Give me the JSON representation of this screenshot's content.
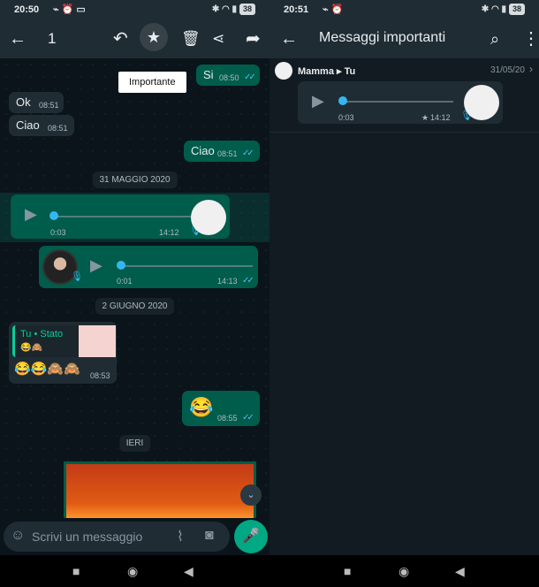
{
  "left": {
    "status": {
      "time": "20:50",
      "battery": "38"
    },
    "appbar": {
      "selected_count": "1"
    },
    "tooltip": "Importante",
    "messages": {
      "si": {
        "text": "Si",
        "time": "08:50"
      },
      "ok": {
        "text": "Ok",
        "time": "08:51"
      },
      "ciao_in": {
        "text": "Ciao",
        "time": "08:51"
      },
      "ciao_out": {
        "text": "Ciao",
        "time": "08:51"
      },
      "date1": "31 MAGGIO 2020",
      "voice1": {
        "duration": "0:03",
        "time": "14:12"
      },
      "voice2": {
        "duration": "0:01",
        "time": "14:13"
      },
      "date2": "2 GIUGNO 2020",
      "status_reply": {
        "title": "Tu • Stato",
        "line": "😂🙈",
        "time": "08:53",
        "emojis": "😂😂🙈🙈"
      },
      "laugh": {
        "emoji": "😂",
        "time": "08:55"
      },
      "date3": "IERI"
    },
    "input": {
      "placeholder": "Scrivi un messaggio"
    }
  },
  "right": {
    "status": {
      "time": "20:51",
      "battery": "38"
    },
    "appbar": {
      "title": "Messaggi importanti"
    },
    "starred": {
      "sender": "Mamma ▸ Tu",
      "date": "31/05/20",
      "duration": "0:03",
      "time": "14:12"
    }
  },
  "colors": {
    "header": "#1f2c34",
    "accent": "#00a884",
    "outgoing": "#005c4b",
    "incoming": "#202c33",
    "ticks": "#53bdeb"
  },
  "icons": [
    "back-arrow-icon",
    "reply-icon",
    "star-icon",
    "delete-icon",
    "share-icon",
    "forward-icon",
    "search-icon",
    "more-icon",
    "play-icon",
    "mic-icon",
    "emoji-icon",
    "attach-icon",
    "camera-icon"
  ]
}
